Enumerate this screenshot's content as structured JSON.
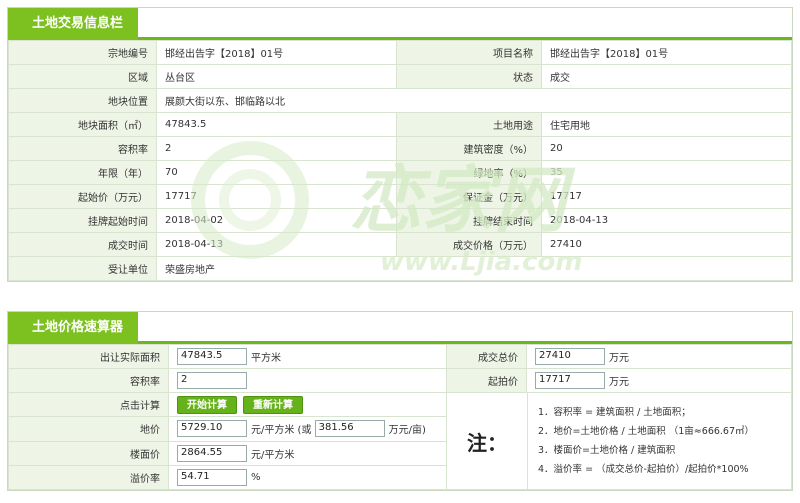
{
  "sections": {
    "info_title": "土地交易信息栏",
    "calc_title": "土地价格速算器"
  },
  "info": {
    "rows": [
      {
        "l1": "宗地编号",
        "v1": "邯经出告字【2018】01号",
        "l2": "项目名称",
        "v2": "邯经出告字【2018】01号"
      },
      {
        "l1": "区域",
        "v1": "丛台区",
        "l2": "状态",
        "v2": "成交"
      },
      {
        "l1": "地块位置",
        "v1": "展颜大街以东、邯临路以北"
      },
      {
        "l1": "地块面积（㎡）",
        "v1": "47843.5",
        "l2": "土地用途",
        "v2": "住宅用地"
      },
      {
        "l1": "容积率",
        "v1": "2",
        "l2": "建筑密度（%）",
        "v2": "20"
      },
      {
        "l1": "年限（年）",
        "v1": "70",
        "l2": "绿地率（%）",
        "v2": "35"
      },
      {
        "l1": "起始价（万元）",
        "v1": "17717",
        "l2": "保证金（万元）",
        "v2": "17717"
      },
      {
        "l1": "挂牌起始时间",
        "v1": "2018-04-02",
        "l2": "挂牌结束时间",
        "v2": "2018-04-13"
      },
      {
        "l1": "成交时间",
        "v1": "2018-04-13",
        "l2": "成交价格（万元）",
        "v2": "27410"
      },
      {
        "l1": "受让单位",
        "v1": "荣盛房地产"
      }
    ]
  },
  "calc": {
    "area_label": "出让实际面积",
    "area_value": "47843.5",
    "area_unit": "平方米",
    "deal_total_label": "成交总价",
    "deal_total_value": "27410",
    "deal_total_unit": "万元",
    "far_label": "容积率",
    "far_value": "2",
    "start_price_label": "起拍价",
    "start_price_value": "17717",
    "start_price_unit": "万元",
    "click_label": "点击计算",
    "btn_start": "开始计算",
    "btn_reset": "重新计算",
    "land_price_label": "地价",
    "land_price_value": "5729.10",
    "land_price_unit_a": "元/平方米 (或",
    "land_price_mu_value": "381.56",
    "land_price_unit_b": "万元/亩)",
    "floor_price_label": "楼面价",
    "floor_price_value": "2864.55",
    "floor_price_unit": "元/平方米",
    "premium_label": "溢价率",
    "premium_value": "54.71",
    "premium_unit": "%",
    "note_title": "注：",
    "notes": [
      "1．容积率 = 建筑面积 / 土地面积；",
      "2．地价=土地价格 / 土地面积 （1亩≈666.67㎡）",
      "3．楼面价=土地价格 / 建筑面积",
      "4．溢价率 = （成交总价-起拍价）/起拍价*100%"
    ]
  },
  "watermark": {
    "text": "www.Ljia.com",
    "brand": "恋家网",
    "color": "#cfe6bf"
  },
  "colors": {
    "accent": "#7dc121",
    "label_bg": "#eef5e6",
    "button": "#66b21a"
  }
}
